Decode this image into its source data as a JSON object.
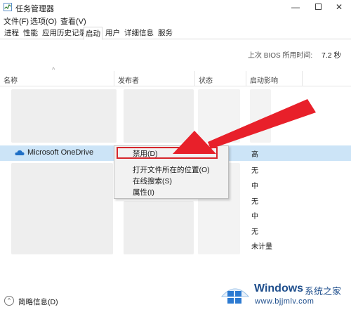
{
  "window": {
    "title": "任务管理器",
    "minimize": "—",
    "close": "✕"
  },
  "menu": [
    "文件(F)",
    "选项(O)",
    "查看(V)"
  ],
  "tabs": [
    "进程",
    "性能",
    "应用历史记录",
    "启动",
    "用户",
    "详细信息",
    "服务"
  ],
  "active_tab": "启动",
  "boot_info": {
    "label": "上次 BIOS 所用时间:",
    "value": "7.2 秒"
  },
  "columns": {
    "name": "名称",
    "publisher": "发布者",
    "status": "状态",
    "impact": "启动影响"
  },
  "selected_row": {
    "name": "Microsoft OneDrive",
    "impact": "高"
  },
  "impacts": [
    "无",
    "中",
    "无",
    "中",
    "无",
    "未计量"
  ],
  "context_menu": [
    "禁用(D)",
    "打开文件所在的位置(O)",
    "在线搜索(S)",
    "属性(I)"
  ],
  "footer": {
    "label": "简略信息(D)"
  },
  "watermark": {
    "brand": "Windows",
    "suffix": "系统之家",
    "url": "www.bjjmlv.com"
  },
  "colors": {
    "selection": "#cce4f7",
    "highlight_box": "#d6262b",
    "arrow": "#e8202a",
    "watermark": "#1e4e8c"
  }
}
